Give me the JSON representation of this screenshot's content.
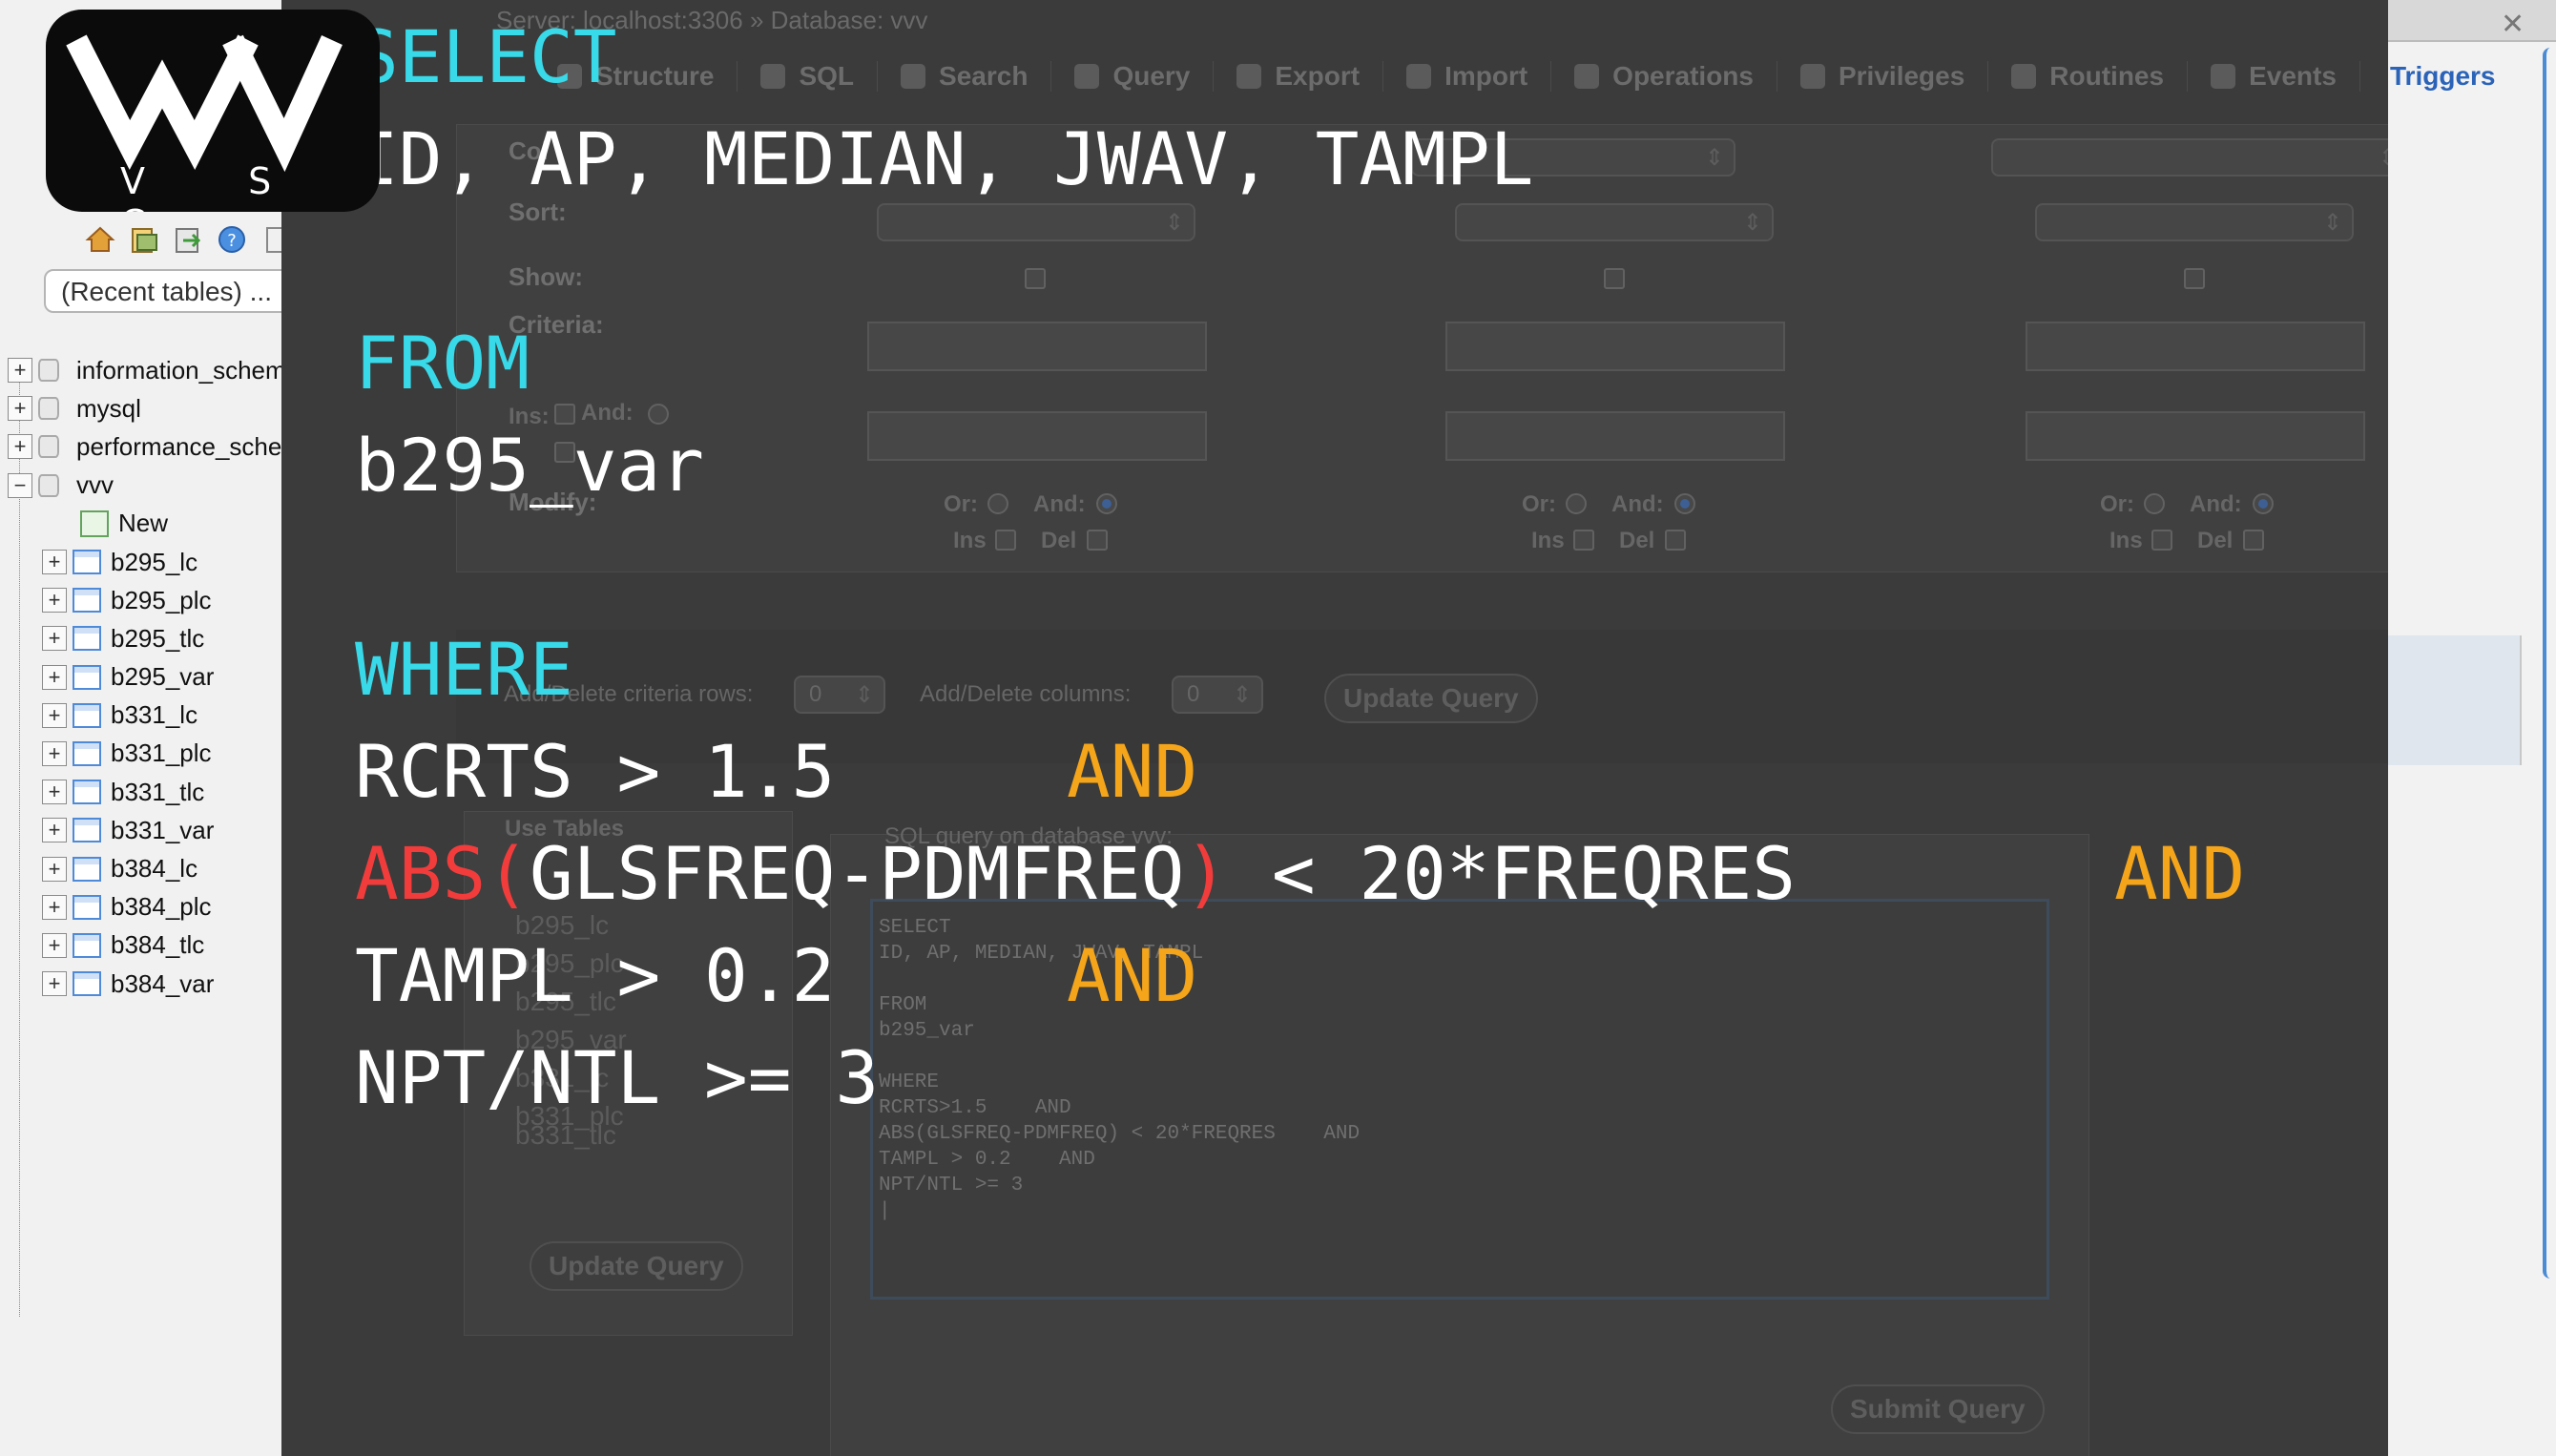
{
  "logo": {
    "letters": "V S C"
  },
  "nav": {
    "icons": [
      "home-icon",
      "database-icon",
      "export-icon",
      "help-icon",
      "docs-icon",
      "reload-icon"
    ],
    "recent_select": "(Recent tables) ...",
    "databases": [
      {
        "name": "information_schema",
        "expanded": false
      },
      {
        "name": "mysql",
        "expanded": false
      },
      {
        "name": "performance_schema",
        "expanded": false
      },
      {
        "name": "vvv",
        "expanded": true
      }
    ],
    "new_label": "New",
    "tables": [
      "b295_lc",
      "b295_plc",
      "b295_tlc",
      "b295_var",
      "b331_lc",
      "b331_plc",
      "b331_tlc",
      "b331_var",
      "b384_lc",
      "b384_plc",
      "b384_tlc",
      "b384_var"
    ]
  },
  "breadcrumb": {
    "server": "Server: localhost:3306",
    "sep": "»",
    "database": "Database: vvv"
  },
  "tabs": [
    "Structure",
    "SQL",
    "Search",
    "Query",
    "Export",
    "Import",
    "Operations",
    "Privileges",
    "Routines",
    "Events",
    "Triggers"
  ],
  "query_form": {
    "col_label": "Col",
    "sort_label": "Sort:",
    "show_label": "Show:",
    "criteria_label": "Criteria:",
    "ins_label": "Ins:",
    "and_label": "And:",
    "modify_label": "Modify:",
    "or_label": "Or:",
    "del_label": "Del",
    "ins2_label": "Ins",
    "add_delete_rows_label": "Add/Delete criteria rows:",
    "add_delete_rows_value": "0",
    "add_delete_cols_label": "Add/Delete columns:",
    "add_delete_cols_value": "0",
    "update_query": "Update Query",
    "use_tables": "Use Tables",
    "sql_query_on_db": "SQL query on database vvv:",
    "submit_query": "Submit Query",
    "use_tables_list": [
      "b295_lc",
      "b295_plc",
      "b295_tlc",
      "b295_var",
      "b331_lc",
      "b331_plc",
      "b331_tlc"
    ],
    "sql_text": "SELECT\nID, AP, MEDIAN, JWAV, TAMPL\n\nFROM\nb295_var\n\nWHERE\nRCRTS>1.5    AND\nABS(GLSFREQ-PDMFREQ) < 20*FREQRES    AND\nTAMPL > 0.2    AND\nNPT/NTL >= 3\n|"
  },
  "overlay_code": {
    "select_kw": "SELECT",
    "columns": "ID, AP, MEDIAN, JWAV, TAMPL",
    "from_kw": "FROM",
    "table": "b295_var",
    "where_kw": "WHERE",
    "cond1": "RCRTS > 1.5",
    "and1": "AND",
    "cond2_fn": "ABS(",
    "cond2_inner": "GLSFREQ-PDMFREQ",
    "cond2_close": ")",
    "cond2_rest": " < 20*FREQRES",
    "and2": "AND",
    "cond3": "TAMPL > 0.2",
    "and3": "AND",
    "cond4": "NPT/NTL >= 3"
  },
  "colors": {
    "keyword": "#38d9e9",
    "and_keyword": "#f5a51a",
    "function": "#f23c3c",
    "code_text": "#ffffff",
    "overlay_bg": "#3b3b3b"
  }
}
